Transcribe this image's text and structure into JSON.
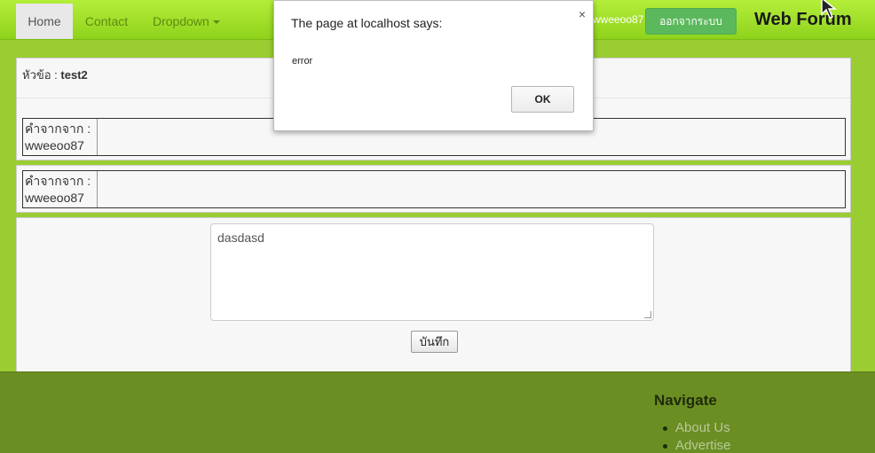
{
  "navbar": {
    "items": [
      {
        "label": "Home"
      },
      {
        "label": "Contact"
      },
      {
        "label": "Dropdown"
      }
    ],
    "user": "wweeoo87",
    "logout_label": "ออกจากระบบ",
    "brand": "Web Forum"
  },
  "topic": {
    "label": "หัวข้อ : ",
    "title": "test2"
  },
  "comments": [
    {
      "author_label": "คำจากจาก :",
      "author": "wweeoo87"
    },
    {
      "author_label": "คำจากจาก :",
      "author": "wweeoo87"
    }
  ],
  "reply": {
    "text": "dasdasd",
    "save_label": "บันทึก"
  },
  "footer": {
    "title": "Navigate",
    "links": [
      "About Us",
      "Advertise"
    ]
  },
  "dialog": {
    "title": "The page at localhost says:",
    "message": "error",
    "close": "×",
    "ok_label": "OK"
  },
  "colors": {
    "page_bg": "#9acd32",
    "navbar": "#8fd21c",
    "logout": "#5cb85c",
    "footer": "#6b8e23"
  },
  "icons": [
    "caret-down-icon",
    "close-icon",
    "cursor-icon",
    "resize-grip-icon"
  ]
}
